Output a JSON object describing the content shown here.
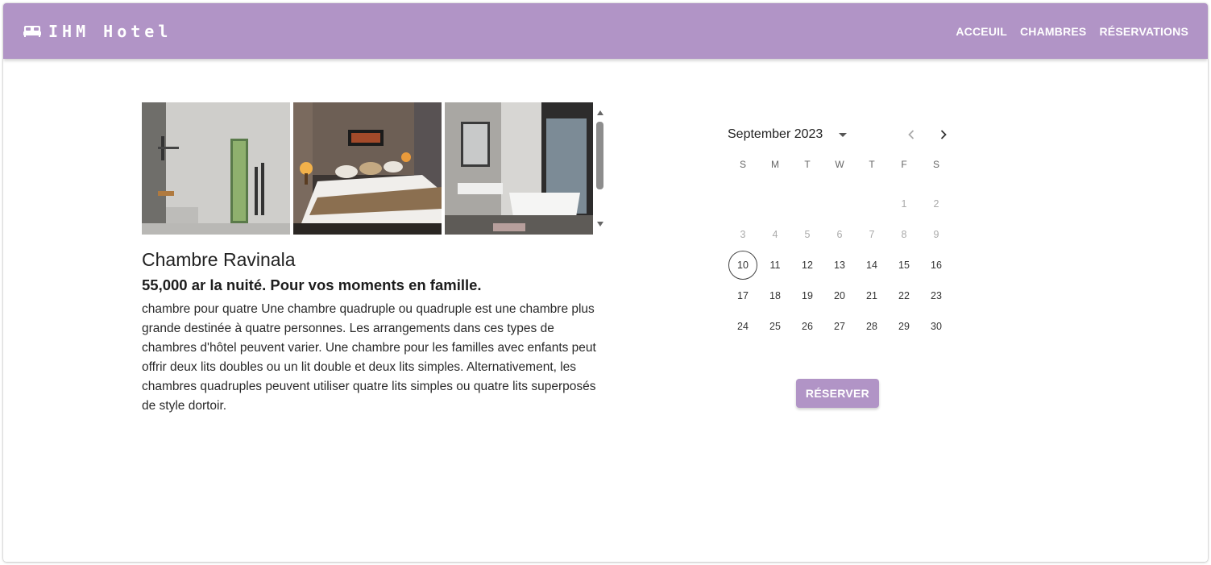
{
  "header": {
    "title": "IHM Hotel",
    "icon": "bed-icon",
    "nav": [
      "ACCEUIL",
      "CHAMBRES",
      "RÉSERVATIONS"
    ],
    "color": "#b194c6"
  },
  "room": {
    "images": [
      "bathroom-photo",
      "bedroom-photo",
      "bathtub-photo"
    ],
    "title": "Chambre Ravinala",
    "price": "55,000 ar la nuité. Pour vos moments en famille.",
    "description": "chambre pour quatre Une chambre quadruple ou quadruple est une chambre plus grande destinée à quatre personnes. Les arrangements dans ces types de chambres d'hôtel peuvent varier. Une chambre pour les familles avec enfants peut offrir deux lits doubles ou un lit double et deux lits simples. Alternativement, les chambres quadruples peuvent utiliser quatre lits simples ou quatre lits superposés de style dortoir."
  },
  "calendar": {
    "month_label": "September 2023",
    "weekdays": [
      "S",
      "M",
      "T",
      "W",
      "T",
      "F",
      "S"
    ],
    "weeks": [
      [
        "",
        "",
        "",
        "",
        "",
        "1",
        "2"
      ],
      [
        "3",
        "4",
        "5",
        "6",
        "7",
        "8",
        "9"
      ],
      [
        "10",
        "11",
        "12",
        "13",
        "14",
        "15",
        "16"
      ],
      [
        "17",
        "18",
        "19",
        "20",
        "21",
        "22",
        "23"
      ],
      [
        "24",
        "25",
        "26",
        "27",
        "28",
        "29",
        "30"
      ]
    ],
    "today": "10",
    "disabled_before": "10"
  },
  "reserve_label": "RÉSERVER"
}
